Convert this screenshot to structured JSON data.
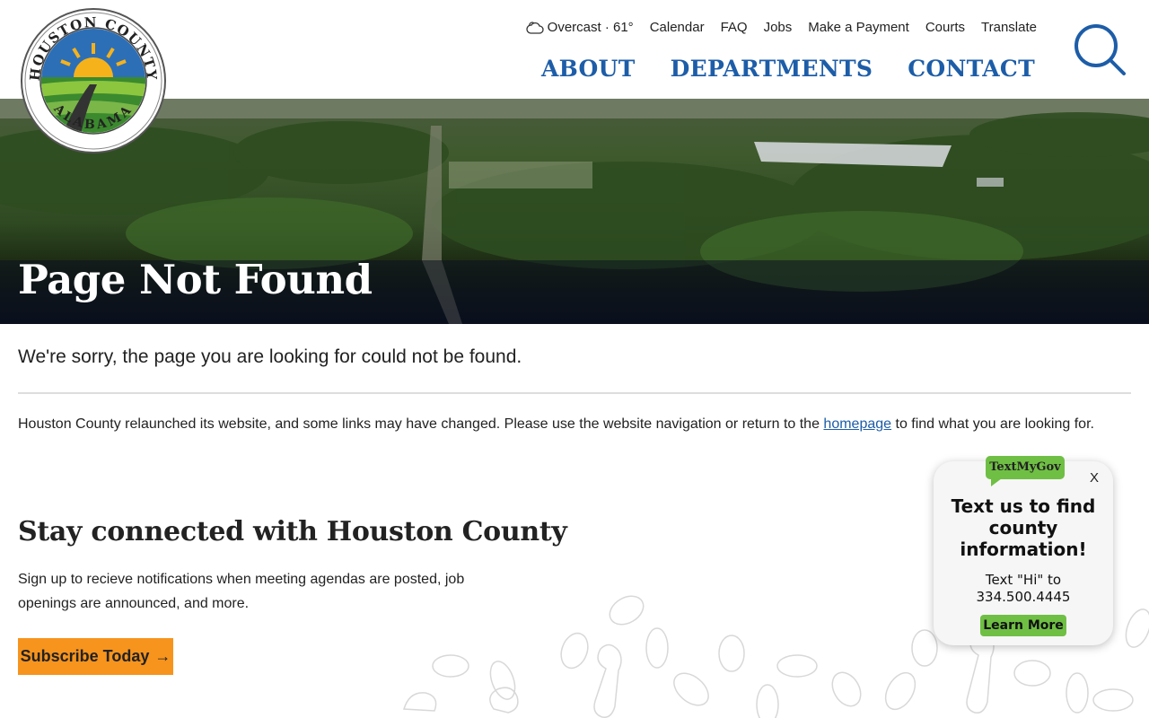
{
  "logo": {
    "top_text": "HOUSTON COUNTY",
    "bottom_text": "ALABAMA"
  },
  "utility_nav": {
    "weather": "Overcast · 61°",
    "links": [
      "Calendar",
      "FAQ",
      "Jobs",
      "Make a Payment",
      "Courts",
      "Translate"
    ]
  },
  "main_nav": [
    "ABOUT",
    "DEPARTMENTS",
    "CONTACT"
  ],
  "hero": {
    "title": "Page Not Found"
  },
  "content": {
    "sorry": "We're sorry, the page you are looking for could not be found.",
    "relaunch_before": "Houston County relaunched its website, and some links may have changed. Please use the website navigation or return to the ",
    "relaunch_link": "homepage",
    "relaunch_after": " to find what you are looking for."
  },
  "newsletter": {
    "title": "Stay connected with Houston County",
    "text": "Sign up to recieve notifications when meeting agendas are posted, job openings are announced, and more.",
    "button": "Subscribe Today",
    "button_arrow": "→"
  },
  "textmygov": {
    "badge": "TextMyGov",
    "close": "X",
    "heading": "Text us to find county information!",
    "line1": "Text \"Hi\" to",
    "line2": "334.500.4445",
    "button": "Learn More"
  },
  "colors": {
    "nav_blue": "#1d5da8",
    "subscribe_orange": "#f7941d",
    "tmg_green": "#6fbf44"
  }
}
